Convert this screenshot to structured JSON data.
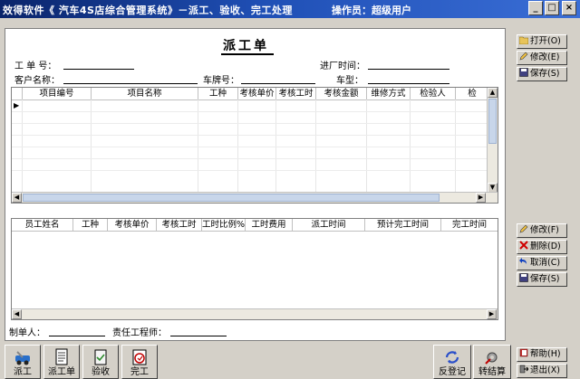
{
  "titlebar": {
    "title": "效得软件《 汽车4S店综合管理系统》－派工、验收、完工处理",
    "operator_label": "操作员：",
    "operator_name": "超级用户"
  },
  "form": {
    "title": "派工单",
    "fields": {
      "order_no_label": "工 单 号：",
      "entry_time_label": "进厂时间：",
      "customer_label": "客户名称：",
      "plate_label": "车牌号：",
      "model_label": "车型："
    },
    "items_grid": {
      "columns": [
        "项目编号",
        "项目名称",
        "工种",
        "考核单价",
        "考核工时",
        "考核金额",
        "维修方式",
        "检验人",
        "检"
      ],
      "row_indicator": "▶"
    },
    "staff_grid": {
      "columns": [
        "员工姓名",
        "工种",
        "考核单价",
        "考核工时",
        "工时比例%",
        "工时费用",
        "派工时间",
        "预计完工时间",
        "完工时间"
      ]
    },
    "footer": {
      "maker_label": "制单人：",
      "engineer_label": "责任工程师："
    }
  },
  "side_buttons": {
    "open": "打开(O)",
    "edit": "修改(E)",
    "save": "保存(S)",
    "edit2": "修改(F)",
    "delete": "删除(D)",
    "cancel": "取消(C)",
    "save2": "保存(S)"
  },
  "toolbar": {
    "dispatch": "派工",
    "dispatch_order": "派工单",
    "accept": "验收",
    "complete": "完工",
    "unregister": "反登记",
    "settle": "转结算",
    "help": "帮助(H)",
    "exit": "退出(X)"
  }
}
